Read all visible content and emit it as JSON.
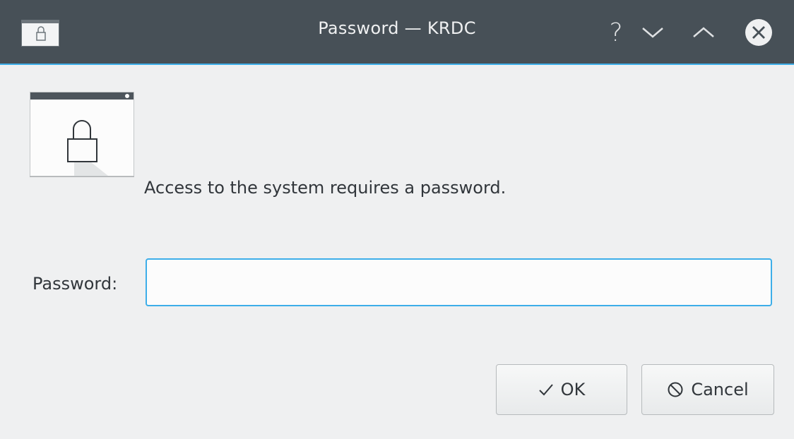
{
  "window": {
    "title": "Password — KRDC",
    "help_symbol": "?"
  },
  "dialog": {
    "message": "Access to the system requires a password.",
    "password_label": "Password:",
    "password_value": "",
    "password_placeholder": ""
  },
  "buttons": {
    "ok_label": "OK",
    "cancel_label": "Cancel"
  },
  "icons": {
    "app": "lock-window-icon",
    "dialog": "lock-window-icon",
    "ok": "checkmark-icon",
    "cancel": "cancel-circle-icon"
  },
  "colors": {
    "titlebar": "#475057",
    "accent": "#3daee9",
    "background": "#eff0f1",
    "text": "#31363b"
  }
}
